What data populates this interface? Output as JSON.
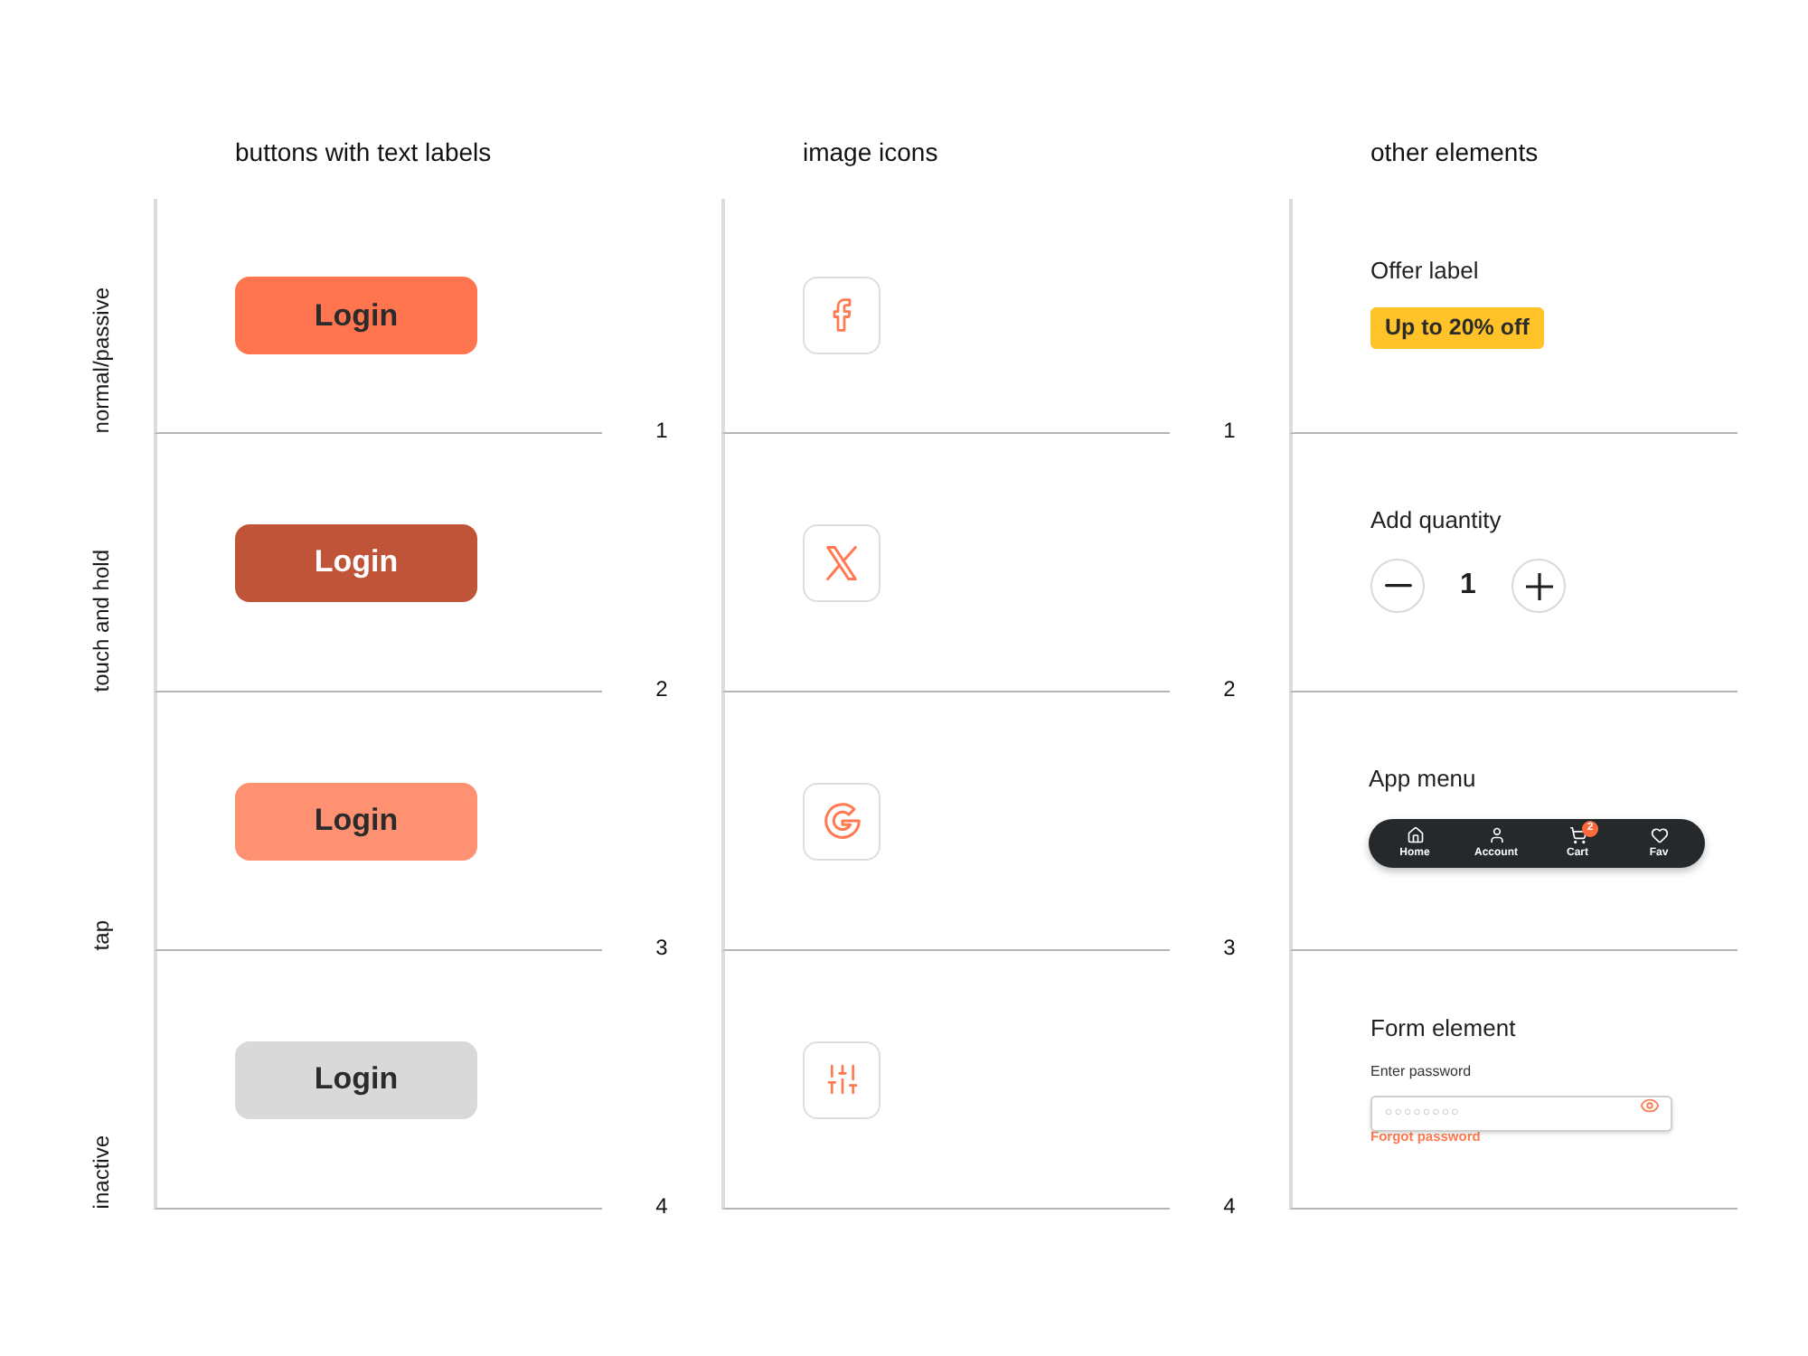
{
  "row_labels": [
    "normal/passive",
    "touch and hold",
    "tap",
    "inactive"
  ],
  "columns": [
    {
      "kind": "buttons",
      "heading": "buttons with text labels",
      "row_numbers": [
        "1",
        "2",
        "3",
        "4"
      ],
      "items": [
        {
          "label": "Login",
          "pressed": false,
          "tapped": false,
          "disabled": false
        },
        {
          "label": "Login",
          "pressed": true,
          "tapped": false,
          "disabled": false
        },
        {
          "label": "Login",
          "pressed": false,
          "tapped": true,
          "disabled": false
        },
        {
          "label": "Login",
          "pressed": false,
          "tapped": false,
          "disabled": true
        }
      ]
    },
    {
      "kind": "icons",
      "heading": "image icons",
      "row_numbers": [
        "1",
        "2",
        "3",
        "4"
      ]
    },
    {
      "kind": "elements",
      "heading": "other elements",
      "items": [
        {
          "kind": "offer",
          "title": "Offer label",
          "badge": "Up to 20% off"
        },
        {
          "kind": "quantity",
          "title": "Add quantity",
          "value": "1"
        },
        {
          "kind": "menu",
          "title": "App menu",
          "items": [
            {
              "label": "Home"
            },
            {
              "label": "Account"
            },
            {
              "label": "Cart",
              "badge": "2"
            },
            {
              "label": "Fav"
            }
          ]
        },
        {
          "kind": "form",
          "title": "Form element",
          "field_label": "Enter password",
          "placeholder": "○○○○○○○○",
          "link": "Forgot password"
        }
      ]
    }
  ]
}
